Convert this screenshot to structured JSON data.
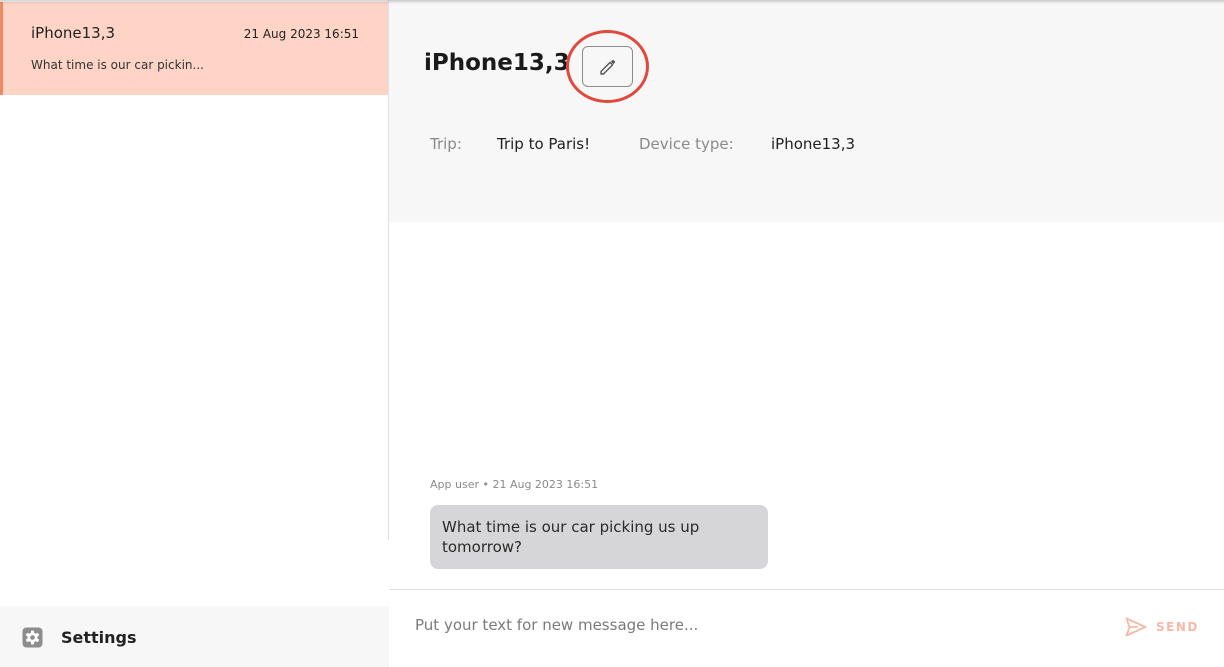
{
  "sidebar": {
    "conversations": [
      {
        "title": "iPhone13,3",
        "time": "21 Aug 2023 16:51",
        "preview": "What time is our car pickin..."
      }
    ],
    "settings_label": "Settings"
  },
  "header": {
    "title": "iPhone13,3",
    "trip_label": "Trip:",
    "trip_value": "Trip to Paris!",
    "device_type_label": "Device type:",
    "device_type_value": "iPhone13,3"
  },
  "messages": [
    {
      "meta": "App user • 21 Aug 2023 16:51",
      "text": "What time is our car picking us up tomorrow?"
    }
  ],
  "composer": {
    "placeholder": "Put your text for new message here...",
    "value": "",
    "send_label": "SEND"
  },
  "colors": {
    "selected_item_bg": "#fdd4c5",
    "accent": "#f08a64",
    "highlight_ring": "#e2483b",
    "send_disabled": "#f7b8a6",
    "bubble_bg": "#d6d6d8"
  },
  "icons": {
    "edit": "pencil-icon",
    "settings": "gear-icon",
    "send": "send-icon"
  }
}
